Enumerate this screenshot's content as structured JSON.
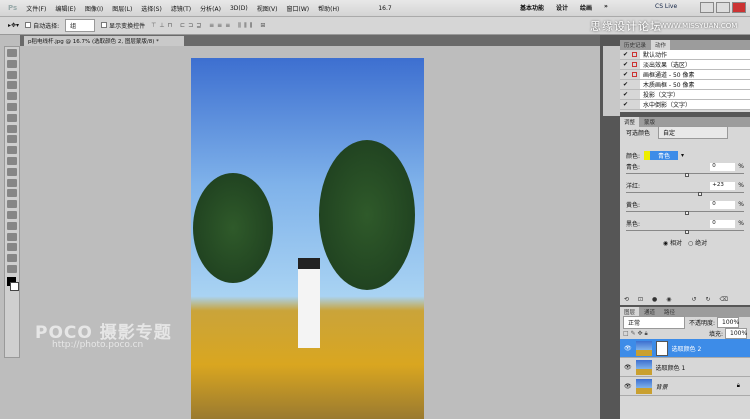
{
  "menubar": {
    "logo": "Ps",
    "items": [
      "文件(F)",
      "编辑(E)",
      "图像(I)",
      "图层(L)",
      "选择(S)",
      "滤镜(T)",
      "分析(A)",
      "3D(D)",
      "视图(V)",
      "窗口(W)",
      "帮助(H)"
    ],
    "zoom": "16.7",
    "workspaces": [
      "基本功能",
      "设计",
      "绘画",
      "»"
    ],
    "cslive": "CS Live"
  },
  "options": {
    "auto_select": "自动选择:",
    "auto_select_value": "组",
    "show_transform": "显示变换控件"
  },
  "watermarks": {
    "site_cn": "思缘设计论坛",
    "site_url": "WWW.MISSYUAN.COM",
    "poco": "POCO 摄影专题",
    "poco_url": "http://photo.poco.cn"
  },
  "document": {
    "tab_title": "p稻电线杆.jpg @ 16.7% (选取颜色 2, 图层蒙版/8) *"
  },
  "actions_panel": {
    "tabs": [
      "历史记录",
      "动作"
    ],
    "items": [
      "默认动作",
      "淡出效果（选区）",
      "画框通道 - 50 像素",
      "木质画框 - 50 像素",
      "投影（文字）",
      "水中倒影（文字）"
    ]
  },
  "adjustments": {
    "tabs": [
      "调整",
      "蒙版"
    ],
    "preset_label": "可选颜色",
    "preset_value": "自定",
    "colors_label": "颜色:",
    "colors_value": "青色",
    "sliders": [
      {
        "label": "青色:",
        "value": "0",
        "pct": 0.5
      },
      {
        "label": "洋红:",
        "value": "+23",
        "pct": 0.61
      },
      {
        "label": "黄色:",
        "value": "0",
        "pct": 0.5
      },
      {
        "label": "黑色:",
        "value": "0",
        "pct": 0.5
      }
    ],
    "unit": "%",
    "method": [
      "相对",
      "绝对"
    ],
    "method_selected": "相对"
  },
  "layers": {
    "tabs": [
      "图层",
      "通道",
      "路径"
    ],
    "blend": "正常",
    "opacity_label": "不透明度:",
    "opacity": "100%",
    "fill_label": "填充:",
    "fill": "100%",
    "items": [
      {
        "name": "选取颜色 2",
        "selected": true
      },
      {
        "name": "选取颜色 1",
        "selected": false
      },
      {
        "name": "背景",
        "selected": false
      }
    ]
  }
}
